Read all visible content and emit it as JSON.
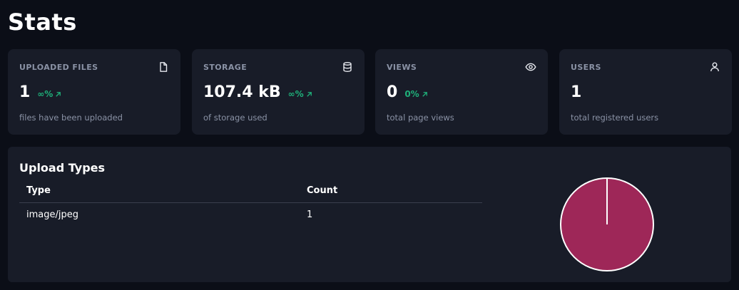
{
  "page": {
    "title": "Stats"
  },
  "cards": [
    {
      "label": "UPLOADED FILES",
      "icon": "file-icon",
      "value": "1",
      "change": "∞%",
      "desc": "files have been uploaded"
    },
    {
      "label": "STORAGE",
      "icon": "database-icon",
      "value": "107.4 kB",
      "change": "∞%",
      "desc": "of storage used"
    },
    {
      "label": "VIEWS",
      "icon": "eye-icon",
      "value": "0",
      "change": "0%",
      "desc": "total page views"
    },
    {
      "label": "USERS",
      "icon": "user-icon",
      "value": "1",
      "desc": "total registered users"
    }
  ],
  "upload_types": {
    "title": "Upload Types",
    "columns": [
      "Type",
      "Count"
    ],
    "rows": [
      {
        "type": "image/jpeg",
        "count": "1"
      }
    ]
  },
  "chart_data": {
    "type": "pie",
    "categories": [
      "image/jpeg"
    ],
    "values": [
      1
    ],
    "colors": [
      "#9e2758"
    ]
  },
  "colors": {
    "background": "#0b0e17",
    "card": "#181c28",
    "muted_text": "#8a92a5",
    "positive": "#1fb07a",
    "pie_slice": "#9e2758"
  }
}
